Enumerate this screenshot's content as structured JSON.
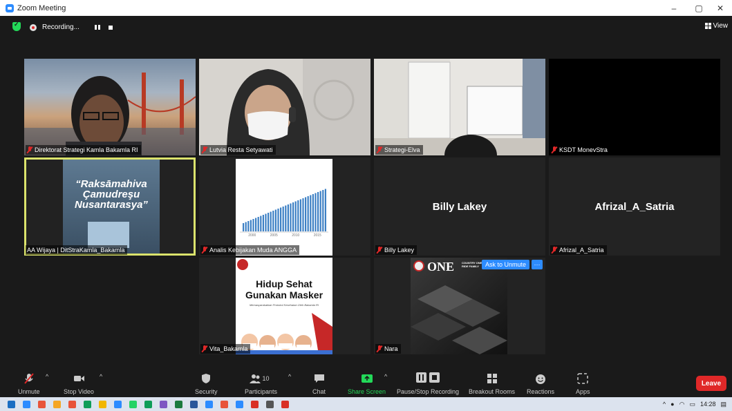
{
  "window": {
    "title": "Zoom Meeting",
    "controls": [
      "–",
      "▢",
      "✕"
    ]
  },
  "topbar": {
    "recording_label": "Recording...",
    "view_label": "View"
  },
  "tiles": [
    {
      "name": "Direktorat Strategi Kamla Bakamla RI",
      "muted": true
    },
    {
      "name": "Lutvia Resta Setyawati",
      "muted": true
    },
    {
      "name": "Strategi-Elva",
      "muted": true
    },
    {
      "name": "KSDT MonevStra",
      "muted": true
    },
    {
      "name": "AA Wijaya | DitStraKamla_Bakamla",
      "muted": false,
      "slide_text": "“Raksāmahiva Çamudreşu Nusantarasya”"
    },
    {
      "name": "Analis Kebijakan Muda ANGGA",
      "muted": true,
      "chart_years": [
        "2000",
        "2005",
        "2010",
        "2015"
      ]
    },
    {
      "name": "Billy Lakey",
      "muted": true,
      "display_name": "Billy Lakey"
    },
    {
      "name": "Afrizal_A_Satria",
      "muted": true,
      "display_name": "Afrizal_A_Satria"
    },
    {
      "name": "Vita_Bakamla",
      "muted": true,
      "poster_title": "Hidup Sehat Gunakan Masker",
      "poster_sub": "Memasyarakatkan Protokol Kesehatan Oleh Bakamla RI"
    },
    {
      "name": "Nara",
      "muted": true,
      "banner_text": "ONE",
      "banner_small": "COUNTRY ONE RIDE FAMILY",
      "ask_unmute": "Ask to Unmute",
      "more": "···"
    }
  ],
  "toolbar": {
    "unmute": "Unmute",
    "stop_video": "Stop Video",
    "security": "Security",
    "participants": "Participants",
    "participants_count": "10",
    "chat": "Chat",
    "share_screen": "Share Screen",
    "pause_stop_recording": "Pause/Stop Recording",
    "breakout_rooms": "Breakout Rooms",
    "reactions": "Reactions",
    "apps": "Apps",
    "leave": "Leave"
  },
  "taskbar": {
    "time": "14:28",
    "colors": [
      "#1b6ec2",
      "#2d8cff",
      "#e8543a",
      "#f5a623",
      "#e8543a",
      "#0f9d58",
      "#f2b700",
      "#2d8cff",
      "#25d366",
      "#0f9d58",
      "#7e57c2",
      "#1b7a3e",
      "#2b579a",
      "#2d8cff",
      "#e8543a",
      "#2d8cff",
      "#d93025",
      "#555",
      "#d93025"
    ]
  }
}
